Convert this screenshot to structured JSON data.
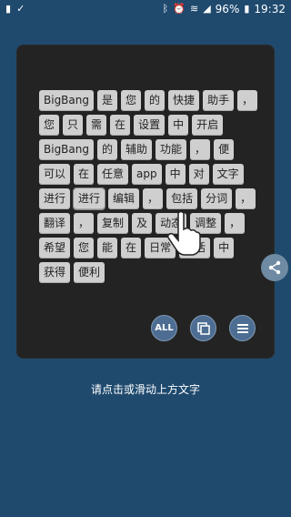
{
  "status": {
    "battery": "96%",
    "time": "19:32"
  },
  "words": [
    "BigBang",
    "是",
    "您",
    "的",
    "快捷",
    "助手",
    "，",
    "您",
    "只",
    "需",
    "在",
    "设置",
    "中",
    "开启",
    "BigBang",
    "的",
    "辅助",
    "功能",
    "，",
    "便",
    "可以",
    "在",
    "任意",
    "app",
    "中",
    "对",
    "文字",
    "进行",
    "进行",
    "编辑",
    "，",
    "包括",
    "分词",
    "，",
    "翻译",
    "，",
    "复制",
    "及",
    "动态",
    "调整",
    "，",
    "希望",
    "您",
    "能",
    "在",
    "日常",
    "生活",
    "中",
    "获得",
    "便利"
  ],
  "actions": {
    "all": "ALL"
  },
  "hint": "请点击或滑动上方文字",
  "icons": {
    "share": "share-icon",
    "copy": "copy-icon",
    "list": "list-icon",
    "cursor": "hand-cursor-icon"
  }
}
